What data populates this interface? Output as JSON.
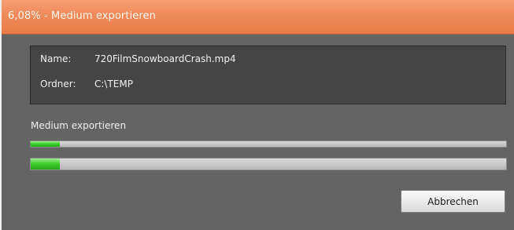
{
  "window": {
    "title": "6,08% - Medium exportieren"
  },
  "info": {
    "name_label": "Name:",
    "name_value": "720FilmSnowboardCrash.mp4",
    "folder_label": "Ordner:",
    "folder_value": "C:\\TEMP"
  },
  "progress_section": {
    "label": "Medium exportieren",
    "bars": [
      {
        "fraction": 0.0608
      },
      {
        "fraction": 0.0608
      }
    ]
  },
  "buttons": {
    "abort_label": "Abbrechen"
  },
  "colors": {
    "titlebar": "#f08a5a",
    "background": "#646464",
    "panel": "#454545",
    "progress_fill": "#3fce2c"
  }
}
